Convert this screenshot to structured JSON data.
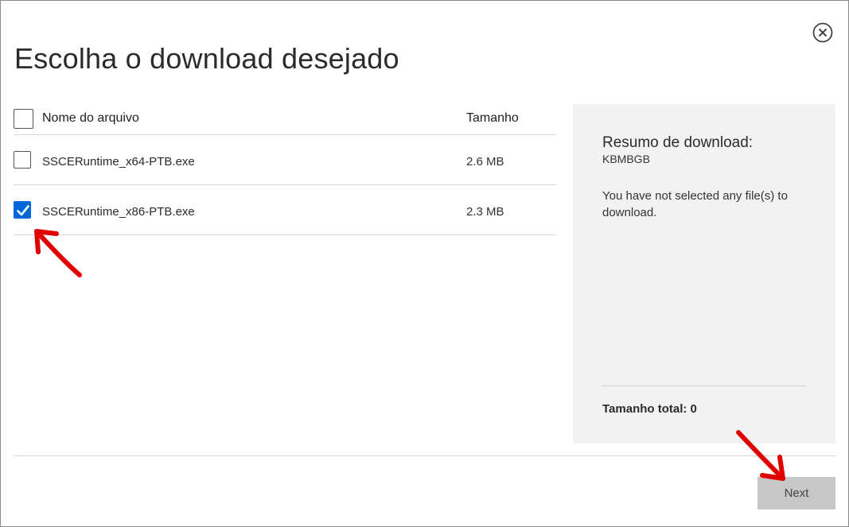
{
  "dialog": {
    "title": "Escolha o download desejado",
    "close_icon": "close-circle-icon"
  },
  "table": {
    "header": {
      "name": "Nome do arquivo",
      "size": "Tamanho",
      "checked": false
    },
    "rows": [
      {
        "name": "SSCERuntime_x64-PTB.exe",
        "size": "2.6 MB",
        "checked": false
      },
      {
        "name": "SSCERuntime_x86-PTB.exe",
        "size": "2.3 MB",
        "checked": true
      }
    ]
  },
  "summary": {
    "title": "Resumo de download:",
    "kb": "KBMBGB",
    "message": "You have not selected any file(s) to download.",
    "total": "Tamanho total: 0"
  },
  "footer": {
    "next_label": "Next"
  },
  "colors": {
    "accent": "#0067d6",
    "annotation": "#e00000"
  }
}
